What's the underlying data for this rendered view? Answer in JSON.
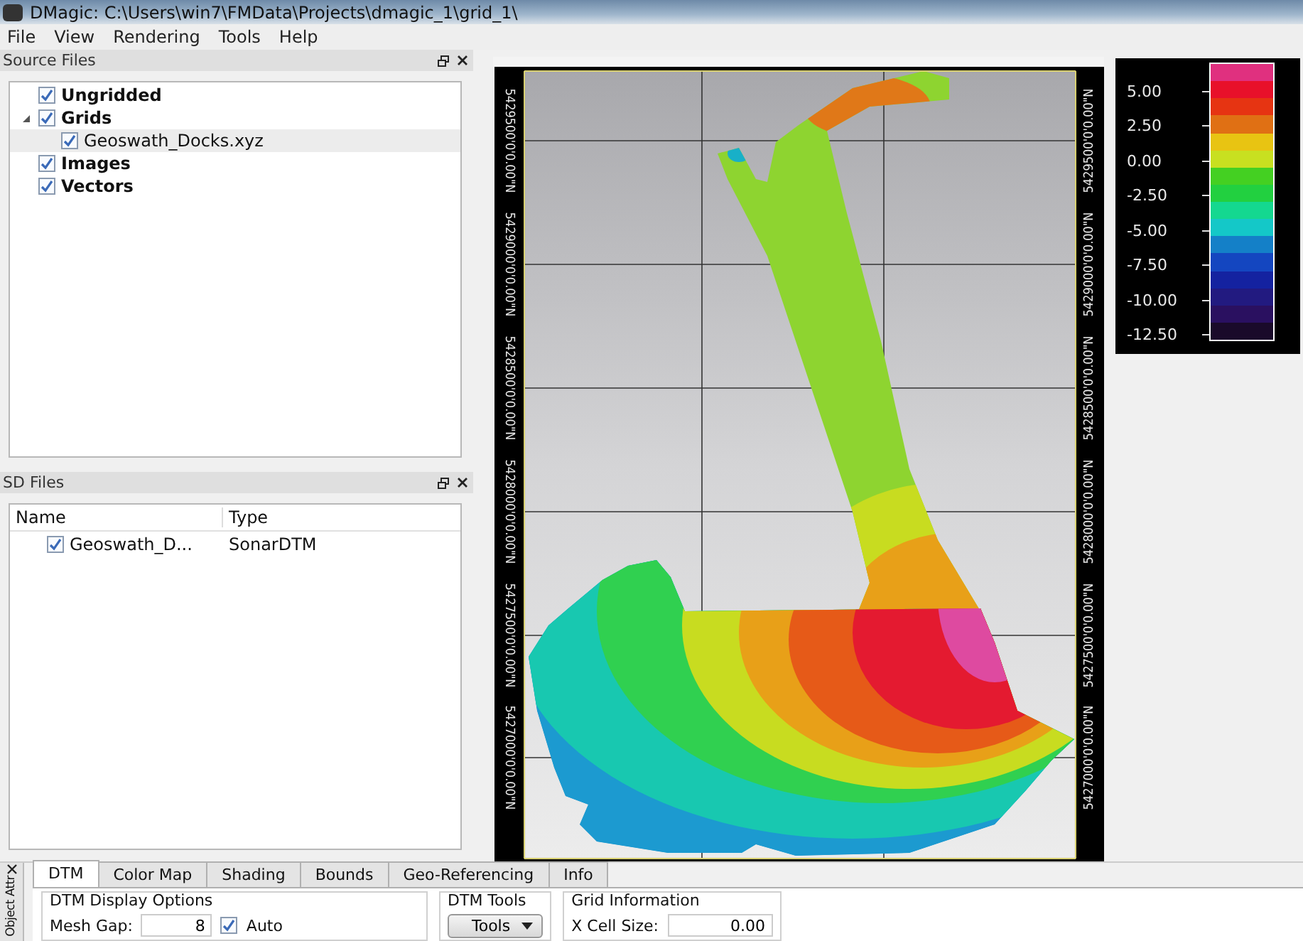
{
  "window": {
    "title": "DMagic: C:\\Users\\win7\\FMData\\Projects\\dmagic_1\\grid_1\\"
  },
  "menu": [
    "File",
    "View",
    "Rendering",
    "Tools",
    "Help"
  ],
  "source_files": {
    "title": "Source Files",
    "tree": [
      {
        "label": "Ungridded",
        "checked": true,
        "selected": false
      },
      {
        "label": "Grids",
        "checked": true,
        "selected": false,
        "expanded": true,
        "children": [
          {
            "label": "Geoswath_Docks.xyz",
            "checked": true,
            "selected": true
          }
        ]
      },
      {
        "label": "Images",
        "checked": true,
        "selected": false
      },
      {
        "label": "Vectors",
        "checked": true,
        "selected": false
      }
    ]
  },
  "sd_files": {
    "title": "SD Files",
    "columns": [
      "Name",
      "Type"
    ],
    "rows": [
      {
        "name": "Geoswath_D...",
        "type": "SonarDTM",
        "checked": true
      }
    ]
  },
  "map": {
    "axis_left": [
      "5429500'0'0.00\"N",
      "5429000'0'0.00\"N",
      "5428500'0'0.00\"N",
      "5428000'0'0.00\"N",
      "5427500'0'0.00\"N",
      "5427000'0'0.00\"N"
    ],
    "axis_right": [
      "5429500'0'0.00\"N",
      "5429000'0'0.00\"N",
      "5428500'0'0.00\"N",
      "5428000'0'0.00\"N",
      "5427500'0'0.00\"N",
      "5427000'0'0.00\"N"
    ]
  },
  "legend": {
    "labels": [
      "5.00",
      "2.50",
      "0.00",
      "-2.50",
      "-5.00",
      "-7.50",
      "-10.00",
      "-12.50"
    ],
    "bands": [
      {
        "color": "#e0307f"
      },
      {
        "color": "#e8102a"
      },
      {
        "color": "#e63412"
      },
      {
        "color": "#e07014"
      },
      {
        "color": "#e8c412"
      },
      {
        "color": "#c8e020"
      },
      {
        "color": "#44d022"
      },
      {
        "color": "#22d040"
      },
      {
        "color": "#14d890"
      },
      {
        "color": "#14c8c8"
      },
      {
        "color": "#1480c8"
      },
      {
        "color": "#1446c0"
      },
      {
        "color": "#1422a0"
      },
      {
        "color": "#221a80"
      },
      {
        "color": "#2a1060"
      },
      {
        "color": "#1a0a2a"
      }
    ]
  },
  "attributes": {
    "side_tab": "Object Attr",
    "tabs": [
      {
        "label": "DTM",
        "selected": true
      },
      {
        "label": "Color Map",
        "selected": false
      },
      {
        "label": "Shading",
        "selected": false
      },
      {
        "label": "Bounds",
        "selected": false
      },
      {
        "label": "Geo-Referencing",
        "selected": false
      },
      {
        "label": "Info",
        "selected": false
      }
    ],
    "display_options": {
      "title": "DTM Display Options",
      "mesh_gap_label": "Mesh Gap:",
      "mesh_gap": "8",
      "auto_label": "Auto",
      "auto_checked": true
    },
    "dtm_tools": {
      "title": "DTM Tools",
      "button": "Tools"
    },
    "grid_info": {
      "title": "Grid Information",
      "x_cell_label": "X Cell Size:",
      "x_cell": "0.00"
    }
  }
}
